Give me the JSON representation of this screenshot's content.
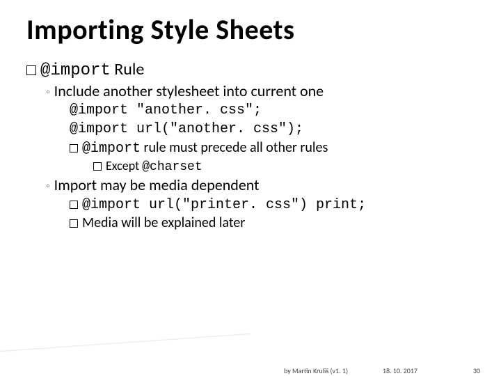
{
  "title": "Importing Style Sheets",
  "lvl1": {
    "code": "@import",
    "rest": " Rule"
  },
  "lvl2_a": "Include another stylesheet into current one",
  "code1": "@import \"another. css\";",
  "code2": "@import url(\"another. css\");",
  "lvl3_a": {
    "code": "@import",
    "rest": " rule must precede all other rules"
  },
  "lvl4_a": {
    "pre": "Except ",
    "code": "@charset"
  },
  "lvl2_b": "Import may be media dependent",
  "lvl3_b": {
    "code": "@import url(\"printer. css\") print;"
  },
  "lvl3_c": "Media will be explained later",
  "footer": {
    "author": "by Martin Kruliš (v1. 1)",
    "date": "18. 10. 2017",
    "page": "30"
  }
}
